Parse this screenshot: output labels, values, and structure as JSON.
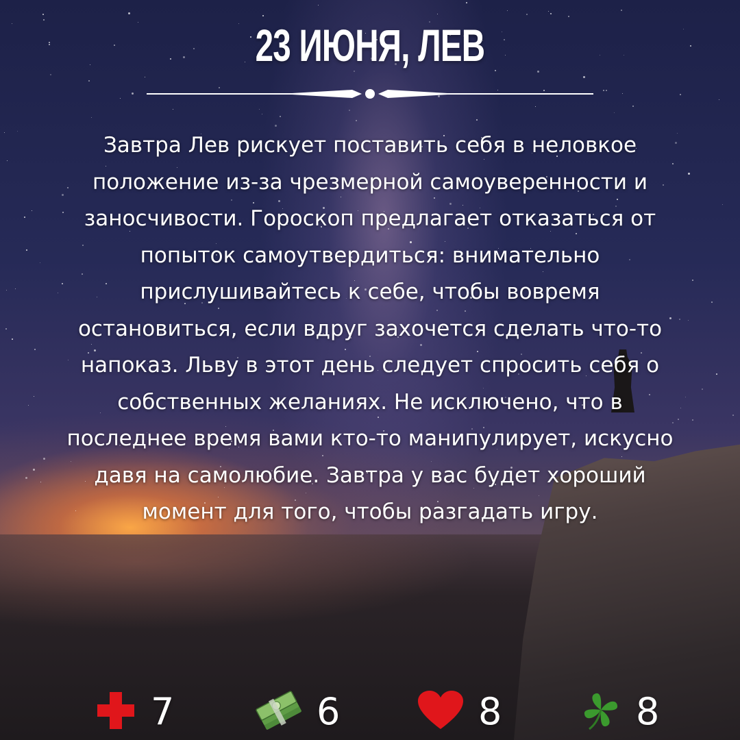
{
  "header": {
    "title": "23 ИЮНЯ, ЛЕВ"
  },
  "horoscope": {
    "text": "Завтра Лев рискует поставить себя в неловкое положение из-за чрезмерной самоуверенности и заносчивости. Гороскоп предлагает отказаться от попыток самоутвердиться: внимательно прислушивайтесь к себе, чтобы вовремя остановиться, если вдруг захочется сделать что-то напоказ. Льву в этот день следует спросить себя о собственных желаниях. Не исключено, что в последнее время вами кто-то манипулирует, искусно давя на самолюбие. Завтра у вас будет хороший момент для того, чтобы разгадать игру."
  },
  "ratings": [
    {
      "icon": "health-cross-icon",
      "value": "7",
      "color": "#e0161b"
    },
    {
      "icon": "money-stack-icon",
      "value": "6",
      "color": "#6aa84f"
    },
    {
      "icon": "heart-icon",
      "value": "8",
      "color": "#e0161b"
    },
    {
      "icon": "four-leaf-clover-icon",
      "value": "8",
      "color": "#3b9a2e"
    }
  ]
}
